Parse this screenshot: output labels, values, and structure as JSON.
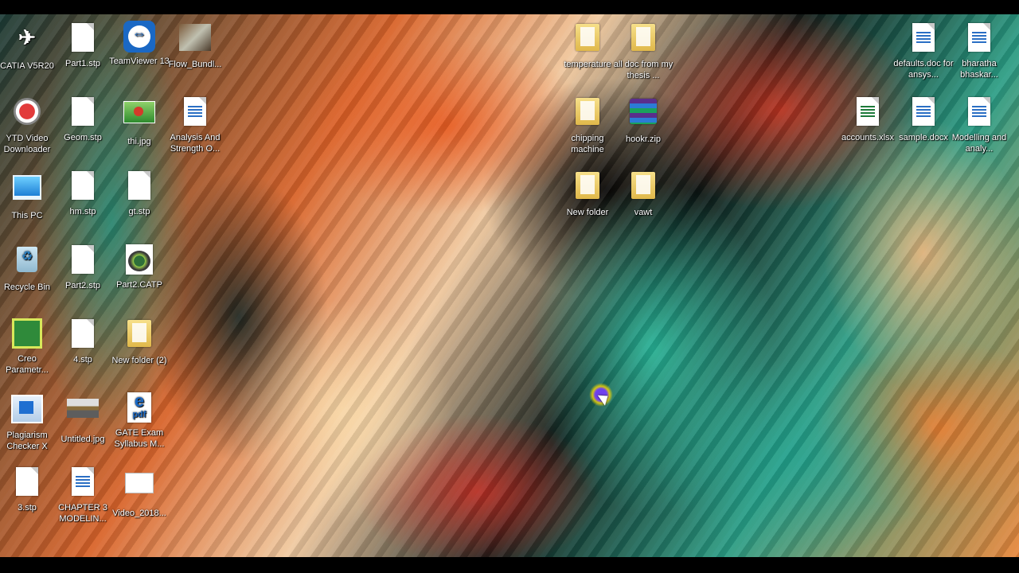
{
  "desktop": {
    "icons": [
      {
        "label": "CATIA V5R20",
        "icon": "catia-icon"
      },
      {
        "label": "Part1.stp",
        "icon": "file-icon"
      },
      {
        "label": "TeamViewer 13",
        "icon": "teamviewer-icon"
      },
      {
        "label": "Flow_Bundl...",
        "icon": "image-file-icon"
      },
      {
        "label": "YTD Video Downloader",
        "icon": "ytd-downloader-icon"
      },
      {
        "label": "Geom.stp",
        "icon": "file-icon"
      },
      {
        "label": "thi.jpg",
        "icon": "image-file-icon"
      },
      {
        "label": "Analysis And Strength O...",
        "icon": "word-document-icon"
      },
      {
        "label": "This PC",
        "icon": "computer-icon"
      },
      {
        "label": "hm.stp",
        "icon": "file-icon"
      },
      {
        "label": "gt.stp",
        "icon": "file-icon"
      },
      {
        "label": "Recycle Bin",
        "icon": "recycle-bin-icon"
      },
      {
        "label": "Part2.stp",
        "icon": "file-icon"
      },
      {
        "label": "Part2.CATP",
        "icon": "catpart-icon"
      },
      {
        "label": "Creo Parametr...",
        "icon": "creo-icon"
      },
      {
        "label": "4.stp",
        "icon": "file-icon"
      },
      {
        "label": "New folder (2)",
        "icon": "folder-icon"
      },
      {
        "label": "Plagiarism Checker X",
        "icon": "plagiarism-checker-icon"
      },
      {
        "label": "Untitled.jpg",
        "icon": "image-file-icon"
      },
      {
        "label": "GATE Exam Syllabus M...",
        "icon": "pdf-icon"
      },
      {
        "label": "3.stp",
        "icon": "file-icon"
      },
      {
        "label": "CHAPTER 3 MODELIN...",
        "icon": "word-document-icon"
      },
      {
        "label": "Video_2018...",
        "icon": "video-file-icon"
      },
      {
        "label": "temperature",
        "icon": "folder-icon"
      },
      {
        "label": "all doc from my thesis ...",
        "icon": "folder-icon"
      },
      {
        "label": "chipping machine",
        "icon": "folder-icon"
      },
      {
        "label": "hookr.zip",
        "icon": "zip-archive-icon"
      },
      {
        "label": "New folder",
        "icon": "folder-icon"
      },
      {
        "label": "vawt",
        "icon": "folder-icon"
      },
      {
        "label": "defaults.doc for ansys...",
        "icon": "word-document-icon"
      },
      {
        "label": "bharatha bhaskar...",
        "icon": "word-document-icon"
      },
      {
        "label": "accounts.xlsx",
        "icon": "excel-file-icon"
      },
      {
        "label": "sample.docx",
        "icon": "word-document-icon"
      },
      {
        "label": "Modelling and analy...",
        "icon": "word-document-icon"
      }
    ]
  }
}
